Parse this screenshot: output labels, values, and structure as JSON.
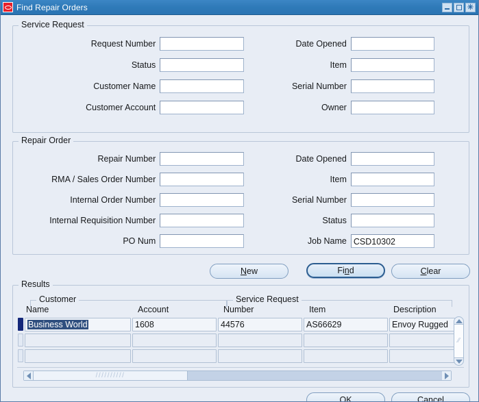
{
  "window": {
    "title": "Find Repair Orders",
    "logo_icon": "oracle-logo-icon",
    "controls": {
      "minimize": "minimize-icon",
      "maximize": "maximize-icon",
      "close": "close-icon"
    }
  },
  "colors": {
    "titlebar": "#2f7ab8",
    "background": "#e8edf5",
    "accent": "#2c5d90",
    "selection": "#2f4f7f",
    "row_marker_selected": "#14287a",
    "logo_red": "#e8202a"
  },
  "service_request": {
    "legend": "Service Request",
    "left_fields": [
      {
        "label": "Request Number",
        "value": ""
      },
      {
        "label": "Status",
        "value": ""
      },
      {
        "label": "Customer Name",
        "value": ""
      },
      {
        "label": "Customer Account",
        "value": ""
      }
    ],
    "right_fields": [
      {
        "label": "Date Opened",
        "value": ""
      },
      {
        "label": "Item",
        "value": ""
      },
      {
        "label": "Serial Number",
        "value": ""
      },
      {
        "label": "Owner",
        "value": ""
      }
    ]
  },
  "repair_order": {
    "legend": "Repair Order",
    "left_fields": [
      {
        "label": "Repair Number",
        "value": ""
      },
      {
        "label": "RMA / Sales Order Number",
        "value": ""
      },
      {
        "label": "Internal Order Number",
        "value": ""
      },
      {
        "label": "Internal  Requisition Number",
        "value": ""
      },
      {
        "label": "PO Num",
        "value": ""
      }
    ],
    "right_fields": [
      {
        "label": "Date Opened",
        "value": ""
      },
      {
        "label": "Item",
        "value": ""
      },
      {
        "label": "Serial Number",
        "value": ""
      },
      {
        "label": "Status",
        "value": ""
      },
      {
        "label": "Job Name",
        "value": "CSD10302"
      }
    ]
  },
  "action_buttons": {
    "new": {
      "label": "New",
      "mnemonic": "N"
    },
    "find": {
      "label": "Find",
      "mnemonic": "n",
      "is_default": true
    },
    "clear": {
      "label": "Clear",
      "mnemonic": "C"
    }
  },
  "results": {
    "legend": "Results",
    "groups": [
      {
        "label": "Customer"
      },
      {
        "label": "Service Request"
      }
    ],
    "columns": [
      "Name",
      "Account",
      "Number",
      "Item",
      "Description"
    ],
    "rows": [
      {
        "selected": true,
        "cells": [
          "Business World",
          "1608",
          "44576",
          "AS66629",
          "Envoy Rugged"
        ]
      },
      {
        "selected": false,
        "cells": [
          "",
          "",
          "",
          "",
          ""
        ]
      },
      {
        "selected": false,
        "cells": [
          "",
          "",
          "",
          "",
          ""
        ]
      }
    ],
    "vertical_scrollbar": {
      "up_icon": "scroll-up-icon",
      "down_icon": "scroll-down-icon",
      "grip": "⁄⁄"
    },
    "horizontal_scrollbar": {
      "left_icon": "scroll-left-icon",
      "right_icon": "scroll-right-icon",
      "grip": "//////////"
    }
  },
  "dialog_buttons": {
    "ok": {
      "label": "OK",
      "mnemonic": "O"
    },
    "cancel": {
      "label": "Cancel",
      "mnemonic": "a"
    }
  }
}
